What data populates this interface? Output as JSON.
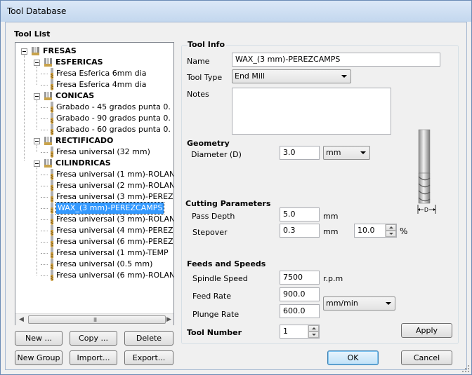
{
  "window": {
    "title": "Tool Database"
  },
  "tool_list": {
    "label": "Tool List",
    "tree": {
      "root": "FRESAS",
      "groups": [
        {
          "name": "ESFERICAS",
          "tools": [
            "Fresa Esferica 6mm dia",
            "Fresa Esferica 4mm dia"
          ]
        },
        {
          "name": "CONICAS",
          "tools": [
            "Grabado - 45 grados punta 0.",
            "Grabado - 90 grados punta 0.",
            "Grabado - 60 grados punta 0."
          ]
        },
        {
          "name": "RECTIFICADO",
          "tools": [
            "Fresa universal (32 mm)"
          ]
        },
        {
          "name": "CILINDRICAS",
          "tools": [
            "Fresa universal (1 mm)-ROLAN",
            "Fresa universal (2 mm)-ROLAN",
            "Fresa universal (3 mm)-PEREZ",
            "WAX_(3 mm)-PEREZCAMPS",
            "Fresa universal (3 mm)-ROLAN",
            "Fresa universal (4 mm)-PEREZ",
            "Fresa universal (6 mm)-PEREZ",
            "Fresa universal (1 mm)-TEMP",
            "Fresa universal (0.5 mm)",
            "Fresa universal (6 mm)-ROLAN"
          ]
        }
      ],
      "selected": "WAX_(3 mm)-PEREZCAMPS"
    },
    "buttons": {
      "new": "New ...",
      "copy": "Copy ...",
      "delete": "Delete",
      "new_group": "New Group",
      "import": "Import...",
      "export": "Export..."
    }
  },
  "tool_info": {
    "label": "Tool Info",
    "name_label": "Name",
    "name_value": "WAX_(3 mm)-PEREZCAMPS",
    "type_label": "Tool Type",
    "type_value": "End Mill",
    "notes_label": "Notes",
    "notes_value": ""
  },
  "geometry": {
    "label": "Geometry",
    "diameter_label": "Diameter (D)",
    "diameter_value": "3.0",
    "units_value": "mm",
    "diagram_label": "D"
  },
  "cutting": {
    "label": "Cutting Parameters",
    "pass_depth_label": "Pass Depth",
    "pass_depth_value": "5.0",
    "pass_depth_unit": "mm",
    "stepover_label": "Stepover",
    "stepover_value": "0.3",
    "stepover_unit": "mm",
    "stepover_percent_value": "10.0",
    "percent_sign": "%"
  },
  "feeds": {
    "label": "Feeds and Speeds",
    "spindle_label": "Spindle Speed",
    "spindle_value": "7500",
    "spindle_unit": "r.p.m",
    "feed_label": "Feed Rate",
    "feed_value": "900.0",
    "plunge_label": "Plunge Rate",
    "plunge_value": "600.0",
    "rate_units_value": "mm/min"
  },
  "tool_number": {
    "label": "Tool Number",
    "value": "1"
  },
  "actions": {
    "apply": "Apply",
    "ok": "OK",
    "cancel": "Cancel"
  },
  "scrollbar": {
    "grip": "III"
  }
}
